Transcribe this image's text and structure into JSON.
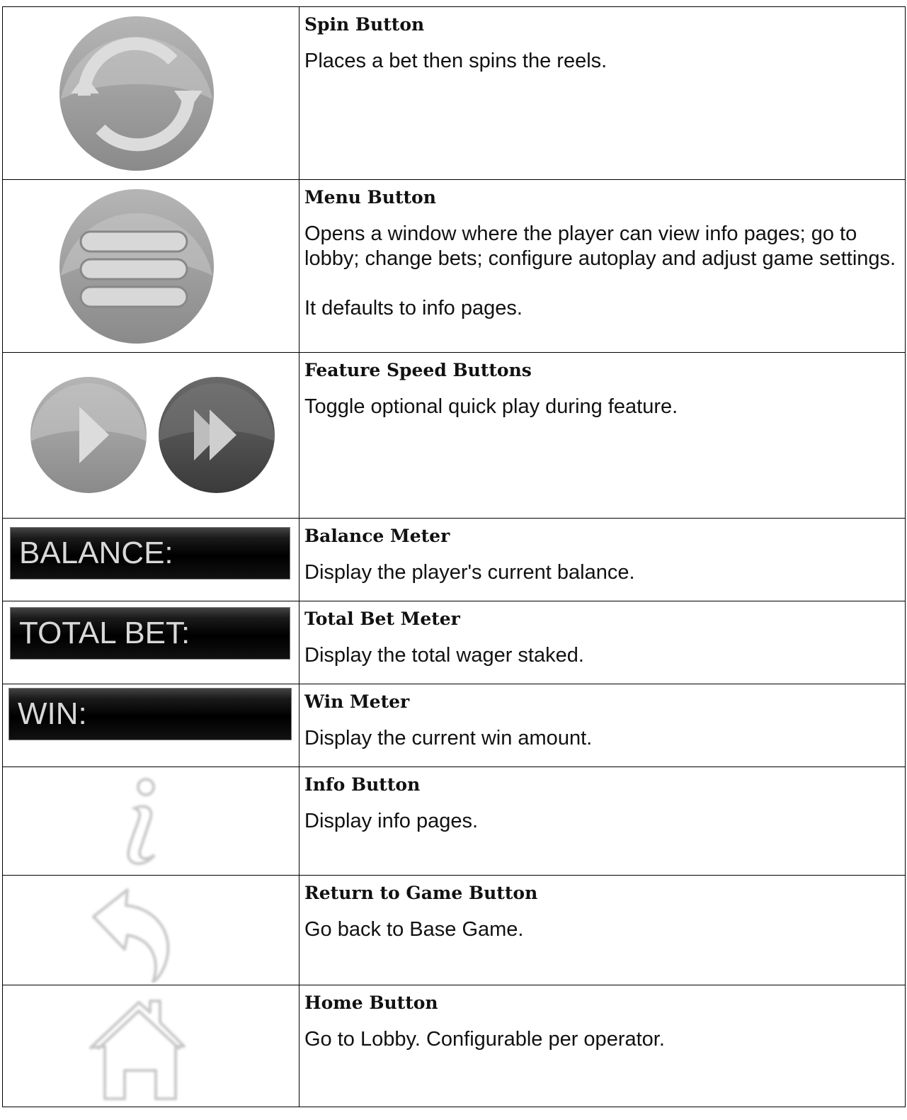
{
  "rows": [
    {
      "title": "Spin Button",
      "desc": [
        "Places a bet then spins the reels."
      ],
      "icon": "spin-icon"
    },
    {
      "title": "Menu Button",
      "desc": [
        "Opens a window where the player can view info pages; go to lobby; change bets; configure autoplay and adjust game settings.",
        "It defaults to info pages."
      ],
      "icon": "menu-icon"
    },
    {
      "title": "Feature Speed Buttons",
      "desc": [
        "Toggle optional quick play during feature."
      ],
      "icon": "speed-icons"
    },
    {
      "title": "Balance Meter",
      "desc": [
        "Display the player's current balance."
      ],
      "meter_label": "BALANCE:"
    },
    {
      "title": "Total Bet Meter",
      "desc": [
        "Display the total wager staked."
      ],
      "meter_label": "TOTAL BET:"
    },
    {
      "title": "Win Meter",
      "desc": [
        "Display the current win amount."
      ],
      "meter_label": "WIN:"
    },
    {
      "title": "Info Button",
      "desc": [
        "Display info pages."
      ],
      "icon": "info-icon"
    },
    {
      "title": "Return to Game Button",
      "desc": [
        "Go back to Base Game."
      ],
      "icon": "return-arrow-icon"
    },
    {
      "title": "Home Button",
      "desc": [
        "Go to Lobby. Configurable per operator."
      ],
      "icon": "home-icon"
    }
  ]
}
